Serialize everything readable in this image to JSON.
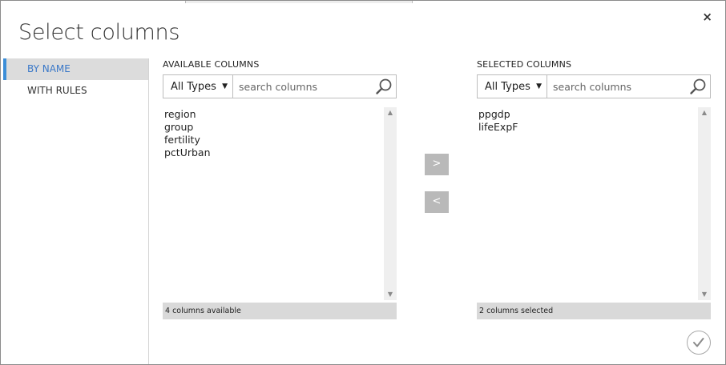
{
  "dialog": {
    "title": "Select columns",
    "close_icon": "×"
  },
  "sidebar": {
    "items": [
      {
        "label": "BY NAME",
        "active": true
      },
      {
        "label": "WITH RULES",
        "active": false
      }
    ]
  },
  "available": {
    "label": "AVAILABLE COLUMNS",
    "type_filter": "All Types",
    "search_placeholder": "search columns",
    "items": [
      "region",
      "group",
      "fertility",
      "pctUrban"
    ],
    "status": "4 columns available"
  },
  "selected": {
    "label": "SELECTED COLUMNS",
    "type_filter": "All Types",
    "search_placeholder": "search columns",
    "items": [
      "ppgdp",
      "lifeExpF"
    ],
    "status": "2 columns selected"
  },
  "actions": {
    "add_label": ">",
    "remove_label": "<"
  },
  "colors": {
    "accent": "#3c8ed8",
    "button_gray": "#b9b9b9",
    "status_bg": "#d9d9d9"
  }
}
